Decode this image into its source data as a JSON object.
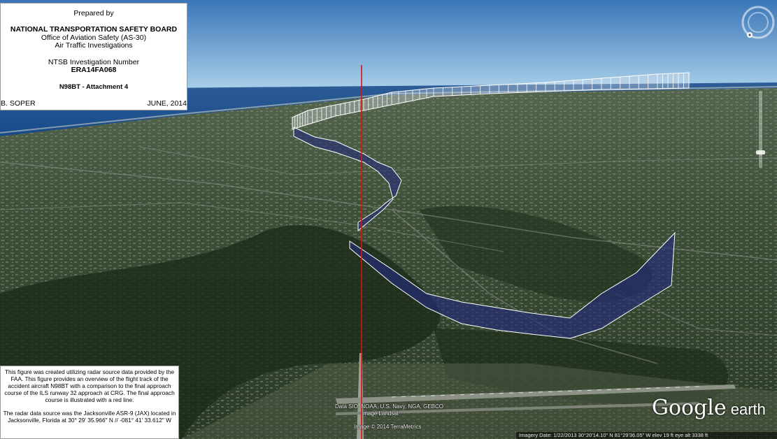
{
  "title_box": {
    "prepared_by": "Prepared by",
    "organization": "NATIONAL TRANSPORTATION SAFETY BOARD",
    "office": "Office of Aviation Safety (AS-30)",
    "division": "Air Traffic Investigations",
    "investigation_label": "NTSB Investigation Number",
    "investigation_number": "ERA14FA068",
    "attachment": "N98BT - Attachment 4",
    "author": "B. SOPER",
    "date": "JUNE, 2014"
  },
  "note_box": {
    "paragraph_1": "This figure was created utilizing radar source data provided by the FAA. This figure provides an overview of the flight track of the accident aircraft N98BT with a comparison to the final approach course of the ILS runway 32 approach at CRG. The final approach course is illustrated with a red line.",
    "paragraph_2": "The radar data source was the Jacksonville ASR-9 (JAX) located in Jacksonville, Florida at 30° 29' 35.966\" N // -081° 41' 33.612\" W"
  },
  "map_credits": {
    "line_1": "Data SIO, NOAA, U.S. Navy, NGA, GEBCO",
    "line_2": "Image Landsat",
    "line_3": "Image © 2014 TerraMetrics"
  },
  "logo": {
    "brand": "Google",
    "product": " earth"
  },
  "status_bar": {
    "text": "Imagery Date: 1/22/2013    30°20'14.10\" N  81°29'36.05\" W  elev   19 ft    eye alt  3338 ft"
  },
  "icons": {
    "nav": "compass-nav-icon",
    "zoom": "zoom-slider-icon"
  },
  "colors": {
    "track_fill": "#242c7a",
    "approach_line": "#e01010",
    "ocean": "#1d4f8f",
    "sky_top": "#3f7fbf",
    "sky_horizon": "#a8cde8",
    "land": "#3a4a34"
  }
}
